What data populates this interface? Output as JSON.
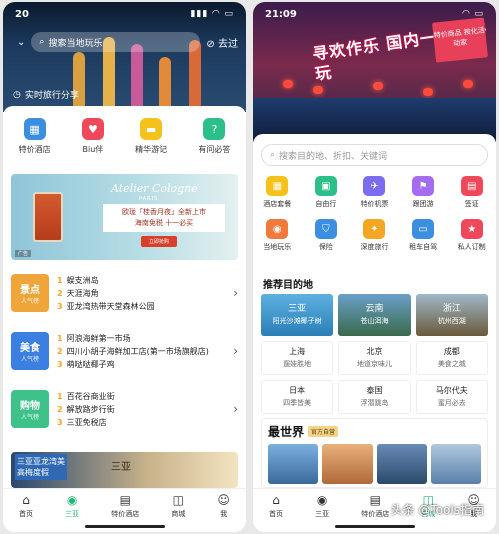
{
  "left": {
    "status": {
      "time": "20",
      "icons": "▮▮▮ ◠ ▭"
    },
    "city": "",
    "search_placeholder": "搜索当地玩乐",
    "checkin_label": "去过",
    "share_label": "实时旅行分享",
    "categories": [
      {
        "label": "特价酒店",
        "icon": "building-icon",
        "color": "#3b8ee0"
      },
      {
        "label": "Biu伴",
        "icon": "heart-icon",
        "color": "#f0485b"
      },
      {
        "label": "精华游记",
        "icon": "note-icon",
        "color": "#f5c21b"
      },
      {
        "label": "有问必答",
        "icon": "question-icon",
        "color": "#2cbf8a"
      }
    ],
    "banner": {
      "brand": "Atelier Cologne",
      "brand_sub": "PARIS",
      "line1": "欧珑「桂香月夜」全新上市",
      "line2": "海南免税 十一必买",
      "button": "立即抢购",
      "tag": "广告"
    },
    "rankings": [
      {
        "tile": "景点",
        "tile_sub": "人气榜",
        "color": "#f0a53a",
        "items": [
          "蜈支洲岛",
          "天涯海角",
          "亚龙湾热带天堂森林公园"
        ]
      },
      {
        "tile": "美食",
        "tile_sub": "人气榜",
        "color": "#3b7fe0",
        "items": [
          "阿浪海鲜第一市场",
          "四川小胡子海鲜加工店(第一市场旗舰店)",
          "萌哒哒椰子鸡"
        ]
      },
      {
        "tile": "购物",
        "tile_sub": "人气榜",
        "color": "#3fc28a",
        "items": [
          "百花谷商业街",
          "解放路步行街",
          "三亚免税店"
        ]
      }
    ],
    "promo": {
      "left": "三亚亚龙湾美高梅度假",
      "center": "三亚"
    },
    "tabs": [
      {
        "label": "首页",
        "icon": "home-icon"
      },
      {
        "label": "三亚",
        "icon": "location-icon"
      },
      {
        "label": "特价酒店",
        "icon": "bed-icon"
      },
      {
        "label": "商城",
        "icon": "bag-icon"
      },
      {
        "label": "我",
        "icon": "user-icon"
      }
    ]
  },
  "right": {
    "status": {
      "time": "21:09",
      "icons": "◠ ▭"
    },
    "hero_title": "寻欢作乐 国内一种好好玩",
    "badge": "特价商品 按化活动家",
    "search_placeholder": "搜索目的地、折扣、关键词",
    "services": [
      {
        "label": "酒店套餐",
        "icon": "hotel-icon",
        "color": "#f5c21b"
      },
      {
        "label": "自由行",
        "icon": "luggage-icon",
        "color": "#2cbf8a"
      },
      {
        "label": "特价机票",
        "icon": "plane-icon",
        "color": "#7b6cf0"
      },
      {
        "label": "跟团游",
        "icon": "flag-icon",
        "color": "#a66cf0"
      },
      {
        "label": "签证",
        "icon": "passport-icon",
        "color": "#f0485b"
      },
      {
        "label": "当地玩乐",
        "icon": "camera-icon",
        "color": "#f07a3a"
      },
      {
        "label": "保险",
        "icon": "shield-icon",
        "color": "#3b8ee0"
      },
      {
        "label": "深度旅行",
        "icon": "compass-icon",
        "color": "#f5a623"
      },
      {
        "label": "租车自驾",
        "icon": "car-icon",
        "color": "#3b8ee0"
      },
      {
        "label": "私人订制",
        "icon": "star-icon",
        "color": "#f0485b"
      }
    ],
    "dest_title": "推荐目的地",
    "featured": [
      {
        "name": "三亚",
        "sub": "阳光沙滩椰子树",
        "color": "#2a8fd0"
      },
      {
        "name": "云南",
        "sub": "苍山洱海",
        "color": "#3a7a4a"
      },
      {
        "name": "浙江",
        "sub": "杭州西湖",
        "color": "#8a6a3a"
      }
    ],
    "cities": [
      {
        "name": "上海",
        "sub": "遛娃胜地"
      },
      {
        "name": "北京",
        "sub": "地道京味儿"
      },
      {
        "name": "成都",
        "sub": "美食之城"
      },
      {
        "name": "日本",
        "sub": "四季皆美"
      },
      {
        "name": "泰国",
        "sub": "浮潜跳岛"
      },
      {
        "name": "马尔代夫",
        "sub": "蜜月必去"
      }
    ],
    "best_logo": "最世界",
    "best_tag": "官方自营",
    "best_images": [
      "#4a7fb8",
      "#d98a4a",
      "#3a5f8a",
      "#7aa0c8"
    ],
    "tabs": [
      {
        "label": "首页",
        "icon": "home-icon"
      },
      {
        "label": "三亚",
        "icon": "location-icon"
      },
      {
        "label": "特价酒店",
        "icon": "bed-icon"
      },
      {
        "label": "商城",
        "icon": "bag-icon"
      },
      {
        "label": "我",
        "icon": "user-icon"
      }
    ],
    "watermark": "头条 @Tools指南"
  }
}
